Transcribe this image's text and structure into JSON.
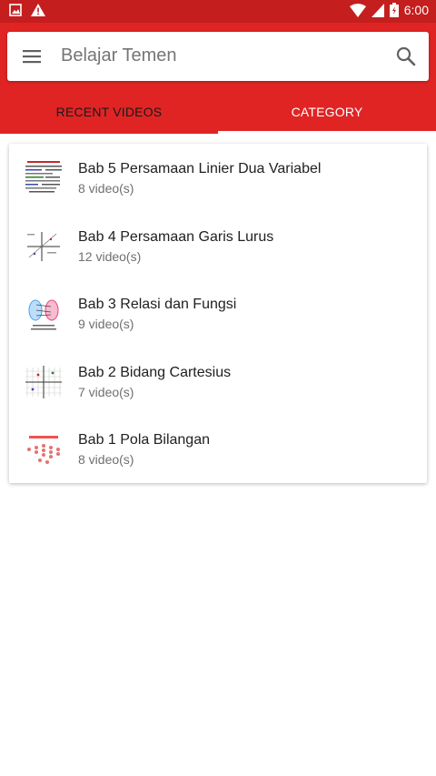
{
  "status_bar": {
    "time": "6:00",
    "left_icons": [
      "image-icon",
      "warning-icon"
    ],
    "right_icons": [
      "wifi-icon",
      "signal-icon",
      "battery-icon"
    ]
  },
  "app_bar": {
    "title": "Belajar Temen",
    "menu_icon": "hamburger-menu-icon",
    "search_icon": "search-icon",
    "color": "#e02424",
    "status_color": "#c41e1e"
  },
  "tabs": [
    {
      "label": "RECENT VIDEOS",
      "selected": false
    },
    {
      "label": "CATEGORY",
      "selected": true
    }
  ],
  "categories": [
    {
      "title": "Bab 5 Persamaan Linier Dua Variabel",
      "count": "8 video(s)"
    },
    {
      "title": "Bab 4 Persamaan Garis Lurus",
      "count": "12 video(s)"
    },
    {
      "title": "Bab 3 Relasi dan Fungsi",
      "count": "9 video(s)"
    },
    {
      "title": "Bab 2 Bidang Cartesius",
      "count": "7 video(s)"
    },
    {
      "title": "Bab 1 Pola Bilangan",
      "count": "8 video(s)"
    }
  ]
}
